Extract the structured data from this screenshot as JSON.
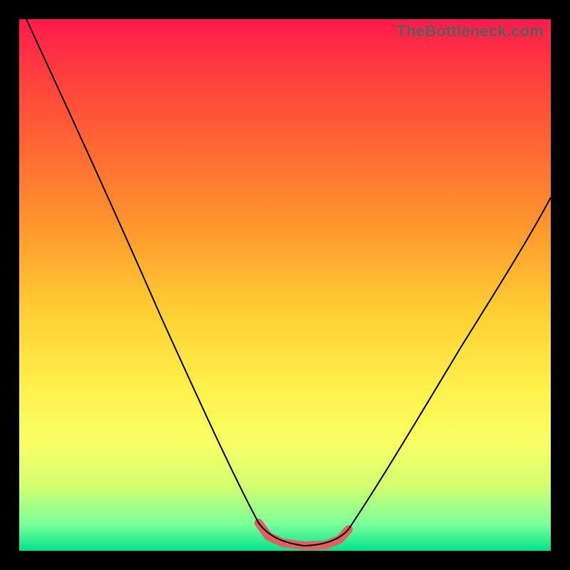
{
  "watermark": "TheBottleneck.com",
  "chart_data": {
    "type": "line",
    "title": "",
    "xlabel": "",
    "ylabel": "",
    "xlim": [
      0,
      100
    ],
    "ylim": [
      0,
      100
    ],
    "background_gradient": {
      "top": "#ff1a4d",
      "bottom": "#00e58a",
      "stops": [
        "#ff1a4d",
        "#ff3d3d",
        "#ff6a33",
        "#ff9a2d",
        "#ffcf33",
        "#fff24d",
        "#f8ff66",
        "#d1ff70",
        "#7aff9a",
        "#00e58a"
      ]
    },
    "series": [
      {
        "name": "bottleneck-curve",
        "x": [
          0,
          5,
          10,
          15,
          20,
          25,
          30,
          35,
          40,
          45,
          48,
          50,
          52,
          55,
          58,
          60,
          65,
          70,
          75,
          80,
          85,
          90,
          95,
          100
        ],
        "values": [
          100,
          90,
          80,
          71,
          62,
          53,
          44,
          35,
          26,
          15,
          8,
          4,
          2,
          1,
          1,
          2,
          5,
          10,
          17,
          25,
          33,
          42,
          51,
          60
        ]
      }
    ],
    "valley_range_x": [
      45,
      62
    ],
    "annotations": []
  }
}
